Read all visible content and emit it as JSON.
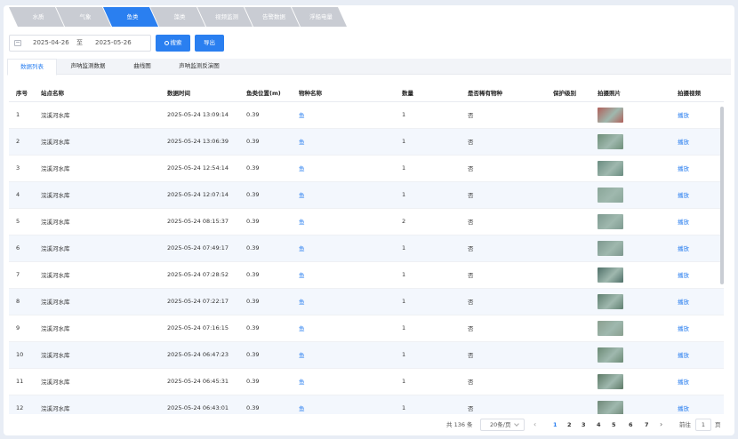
{
  "top_tabs": [
    {
      "label": "水质",
      "color": "#c9ccd3"
    },
    {
      "label": "气象",
      "color": "#c9ccd3"
    },
    {
      "label": "鱼类",
      "color": "#2a7ff0"
    },
    {
      "label": "藻类",
      "color": "#c9ccd3"
    },
    {
      "label": "视频监测",
      "color": "#c9ccd3"
    },
    {
      "label": "告警数据",
      "color": "#c9ccd3"
    },
    {
      "label": "浮船电量",
      "color": "#c9ccd3"
    }
  ],
  "filter": {
    "start_date": "2025-04-26",
    "separator": "至",
    "end_date": "2025-05-26",
    "search_label": "搜索",
    "export_label": "导出"
  },
  "sub_tabs": [
    "数据列表",
    "声呐监测数据",
    "曲线图",
    "声呐监测反演图"
  ],
  "table": {
    "headers": [
      "序号",
      "站点名称",
      "数据时间",
      "鱼类位置(m)",
      "物种名称",
      "数量",
      "是否稀有物种",
      "保护级别",
      "拍摄照片",
      "拍摄视频"
    ],
    "rows": [
      {
        "no": "1",
        "site": "浣溪河水库",
        "time": "2025-05-24 13:09:14",
        "pos": "0.39",
        "species": "鱼",
        "count": "1",
        "rare": "否",
        "level": "",
        "video": "播放",
        "photo": "#b0605a"
      },
      {
        "no": "2",
        "site": "浣溪河水库",
        "time": "2025-05-24 13:06:39",
        "pos": "0.39",
        "species": "鱼",
        "count": "1",
        "rare": "否",
        "level": "",
        "video": "播放",
        "photo": "#6f8f7a"
      },
      {
        "no": "3",
        "site": "浣溪河水库",
        "time": "2025-05-24 12:54:14",
        "pos": "0.39",
        "species": "鱼",
        "count": "1",
        "rare": "否",
        "level": "",
        "video": "播放",
        "photo": "#6a8c80"
      },
      {
        "no": "4",
        "site": "浣溪河水库",
        "time": "2025-05-24 12:07:14",
        "pos": "0.39",
        "species": "鱼",
        "count": "1",
        "rare": "否",
        "level": "",
        "video": "播放",
        "photo": "#8aa699"
      },
      {
        "no": "5",
        "site": "浣溪河水库",
        "time": "2025-05-24 08:15:37",
        "pos": "0.39",
        "species": "鱼",
        "count": "2",
        "rare": "否",
        "level": "",
        "video": "播放",
        "photo": "#7e9a90"
      },
      {
        "no": "6",
        "site": "浣溪河水库",
        "time": "2025-05-24 07:49:17",
        "pos": "0.39",
        "species": "鱼",
        "count": "1",
        "rare": "否",
        "level": "",
        "video": "播放",
        "photo": "#7d978e"
      },
      {
        "no": "7",
        "site": "浣溪河水库",
        "time": "2025-05-24 07:28:52",
        "pos": "0.39",
        "species": "鱼",
        "count": "1",
        "rare": "否",
        "level": "",
        "video": "播放",
        "photo": "#4f6f68"
      },
      {
        "no": "8",
        "site": "浣溪河水库",
        "time": "2025-05-24 07:22:17",
        "pos": "0.39",
        "species": "鱼",
        "count": "1",
        "rare": "否",
        "level": "",
        "video": "播放",
        "photo": "#5f7f70"
      },
      {
        "no": "9",
        "site": "浣溪河水库",
        "time": "2025-05-24 07:16:15",
        "pos": "0.39",
        "species": "鱼",
        "count": "1",
        "rare": "否",
        "level": "",
        "video": "播放",
        "photo": "#8a9f8f"
      },
      {
        "no": "10",
        "site": "浣溪河水库",
        "time": "2025-05-24 06:47:23",
        "pos": "0.39",
        "species": "鱼",
        "count": "1",
        "rare": "否",
        "level": "",
        "video": "播放",
        "photo": "#6b8a75"
      },
      {
        "no": "11",
        "site": "浣溪河水库",
        "time": "2025-05-24 06:45:31",
        "pos": "0.39",
        "species": "鱼",
        "count": "1",
        "rare": "否",
        "level": "",
        "video": "播放",
        "photo": "#5d7a66"
      },
      {
        "no": "12",
        "site": "浣溪河水库",
        "time": "2025-05-24 06:43:01",
        "pos": "0.39",
        "species": "鱼",
        "count": "1",
        "rare": "否",
        "level": "",
        "video": "播放",
        "photo": "#6f8878"
      }
    ]
  },
  "pager": {
    "total": "共 136 条",
    "page_size": "20条/页",
    "pages": [
      "1",
      "2",
      "3",
      "4",
      "5",
      "6",
      "7"
    ],
    "current": "1",
    "goto_label": "前往",
    "goto_value": "1",
    "page_label": "页"
  }
}
